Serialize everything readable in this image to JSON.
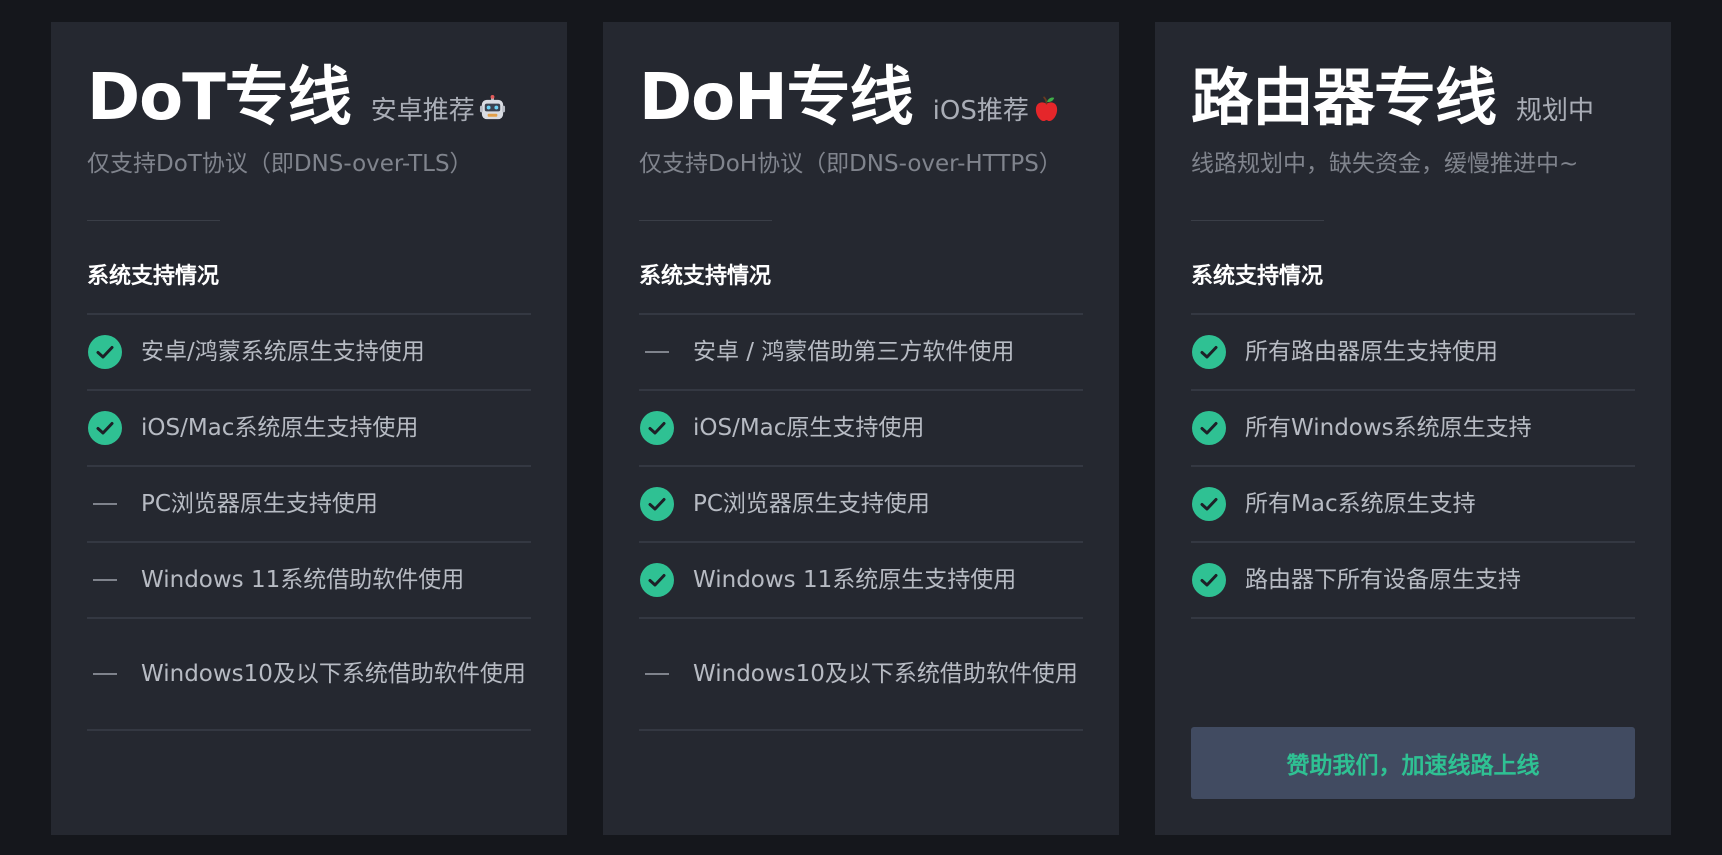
{
  "colors": {
    "page_background": "#15171c",
    "card_background": "#252830",
    "check_green": "#2fc193",
    "button_background": "#414b61",
    "button_text": "#2fc193"
  },
  "cards": [
    {
      "title": "DoT专线",
      "tag": "安卓推荐",
      "tag_icon": "robot-icon",
      "subtitle": "仅支持DoT协议（即DNS-over-TLS）",
      "section_title": "系统支持情况",
      "features": [
        {
          "status": "check",
          "text": "安卓/鸿蒙系统原生支持使用"
        },
        {
          "status": "check",
          "text": "iOS/Mac系统原生支持使用"
        },
        {
          "status": "dash",
          "text": "PC浏览器原生支持使用"
        },
        {
          "status": "dash",
          "text": "Windows 11系统借助软件使用"
        },
        {
          "status": "dash",
          "text": "Windows10及以下系统借助软件使用"
        }
      ]
    },
    {
      "title": "DoH专线",
      "tag": "iOS推荐",
      "tag_icon": "apple-icon",
      "subtitle": "仅支持DoH协议（即DNS-over-HTTPS）",
      "section_title": "系统支持情况",
      "features": [
        {
          "status": "dash",
          "text": "安卓 / 鸿蒙借助第三方软件使用"
        },
        {
          "status": "check",
          "text": "iOS/Mac原生支持使用"
        },
        {
          "status": "check",
          "text": "PC浏览器原生支持使用"
        },
        {
          "status": "check",
          "text": "Windows 11系统原生支持使用"
        },
        {
          "status": "dash",
          "text": "Windows10及以下系统借助软件使用"
        }
      ]
    },
    {
      "title": "路由器专线",
      "tag": "规划中",
      "subtitle": "线路规划中，缺失资金，缓慢推进中~",
      "section_title": "系统支持情况",
      "features": [
        {
          "status": "check",
          "text": "所有路由器原生支持使用"
        },
        {
          "status": "check",
          "text": "所有Windows系统原生支持"
        },
        {
          "status": "check",
          "text": "所有Mac系统原生支持"
        },
        {
          "status": "check",
          "text": "路由器下所有设备原生支持"
        }
      ],
      "button_label": "赞助我们，加速线路上线"
    }
  ]
}
